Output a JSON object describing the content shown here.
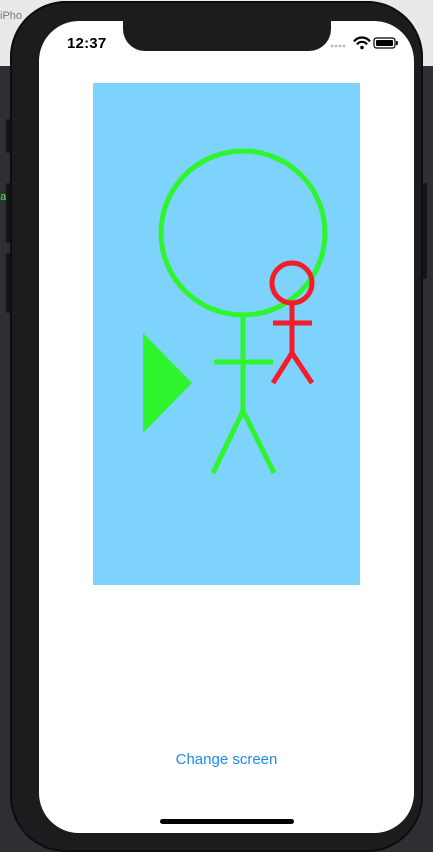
{
  "background": {
    "window_title_fragment": "iPho",
    "console_fragment": "a"
  },
  "status_bar": {
    "time": "12:37",
    "icons": [
      "signal-dots-icon",
      "wifi-icon",
      "battery-icon"
    ]
  },
  "canvas": {
    "background_color": "#7dd3fb",
    "shapes": [
      {
        "kind": "stick-figure",
        "color": "#2ef52e",
        "size": "large"
      },
      {
        "kind": "stick-figure",
        "color": "#f31c2b",
        "size": "small"
      },
      {
        "kind": "triangle",
        "color": "#2ef52e",
        "pointing": "right"
      }
    ]
  },
  "main": {
    "change_screen_label": "Change screen"
  },
  "colors": {
    "accent": "#1a8cf0",
    "green": "#2ef52e",
    "red": "#f31c2b"
  }
}
